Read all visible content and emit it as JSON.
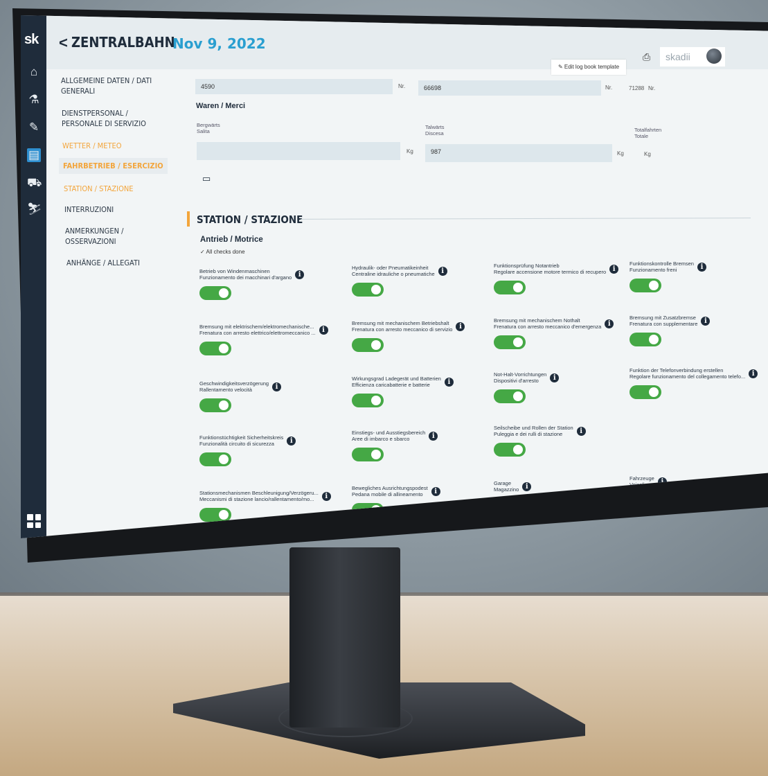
{
  "app": {
    "logo": "sk",
    "back_icon": "chevron-left-icon"
  },
  "header": {
    "title": "ZENTRALBAHN",
    "date": "Nov 9, 2022",
    "edit_button": "Edit log book template",
    "user": "skadii"
  },
  "nav": [
    {
      "label": "ALLGEMEINE DATEN / DATI GENERALI",
      "state": "normal"
    },
    {
      "label": "DIENSTPERSONAL / PERSONALE DI SERVIZIO",
      "state": "normal"
    },
    {
      "label": "WETTER / METEO",
      "state": "orange"
    },
    {
      "label": "FAHRBETRIEB / ESERCIZIO",
      "state": "active"
    },
    {
      "label": "STATION / STAZIONE",
      "state": "orange"
    },
    {
      "label": "INTERRUZIONI",
      "state": "normal"
    },
    {
      "label": "ANMERKUNGEN / OSSERVAZIONI",
      "state": "normal"
    },
    {
      "label": "ANHÄNGE / ALLEGATI",
      "state": "normal"
    }
  ],
  "form": {
    "field1_value": "4590",
    "field1_unit": "Nr.",
    "field2_value": "66698",
    "field2_unit": "Nr.",
    "field3_value": "71288",
    "field3_unit": "Nr.",
    "waren_label": "Waren / Merci",
    "bergwaerts": "Bergwärts",
    "salita": "Salita",
    "talwaerts": "Talwärts",
    "discesa": "Discesa",
    "totalfahrten": "Totalfahrten",
    "totale": "Totale",
    "field4_value": "",
    "field4_unit": "Kg",
    "field5_value": "987",
    "field5_unit": "Kg",
    "field6_unit": "Kg"
  },
  "section": {
    "title": "STATION / STAZIONE",
    "subtitle": "Antrieb / Motrice",
    "checks_status": "All checks done"
  },
  "checks": [
    {
      "de": "Betrieb von Windenmaschinen",
      "it": "Funzionamento dei macchinari d'argano",
      "on": true
    },
    {
      "de": "Hydraulik- oder Pneumatikeinheit",
      "it": "Centraline idrauliche o pneumatiche",
      "on": true
    },
    {
      "de": "Funktionsprüfung Notantrieb",
      "it": "Regolare accensione motore termico di recupero",
      "on": true
    },
    {
      "de": "Funktionskontrolle Bremsen",
      "it": "Funzionamento freni",
      "on": true
    },
    {
      "de": "Bremsung mit elektrischem/elektromechanische...",
      "it": "Frenatura con arresto elettrico/elettromeccanico ...",
      "on": true
    },
    {
      "de": "Bremsung mit mechanischem Betriebshalt",
      "it": "Frenatura con arresto meccanico di servizio",
      "on": true
    },
    {
      "de": "Bremsung mit mechanischem Nothalt",
      "it": "Frenatura con arresto meccanico d'emergenza",
      "on": true
    },
    {
      "de": "Bremsung mit Zusatzbremse",
      "it": "Frenatura con supplementare",
      "on": true
    },
    {
      "de": "Geschwindigkeitsverzögerung",
      "it": "Rallentamento velocità",
      "on": true
    },
    {
      "de": "Wirkungsgrad Ladegerät und Batterien",
      "it": "Efficienza caricabatterie e batterie",
      "on": true
    },
    {
      "de": "Not-Halt-Vorrichtungen",
      "it": "Dispositivi d'arresto",
      "on": true
    },
    {
      "de": "Funktion der Telefonverbindung erstellen",
      "it": "Regolare funzionamento del collegamento telefo...",
      "on": true
    },
    {
      "de": "Funktionstüchtigkeit Sicherheitskreis",
      "it": "Funzionalità circuito di sicurezza",
      "on": true
    },
    {
      "de": "Einstiegs- und Ausstiegsbereich",
      "it": "Aree di imbarco e sbarco",
      "on": true
    },
    {
      "de": "Seilscheibe und Rollen der Station",
      "it": "Puleggia e dei rulli di stazione",
      "on": true
    },
    {
      "de": "Stationsmechanismen Beschleunigung/Verzögeru...",
      "it": "Meccanismi di stazione lancio/rallentamento/mo...",
      "on": true
    },
    {
      "de": "Bewegliches Ausrichtungspodest",
      "it": "Pedana mobile di allineamento",
      "on": true
    },
    {
      "de": "Garage",
      "it": "Magazzino",
      "on": true
    },
    {
      "de": "Fahrzeuge",
      "it": "Veicoli",
      "on": true
    }
  ]
}
